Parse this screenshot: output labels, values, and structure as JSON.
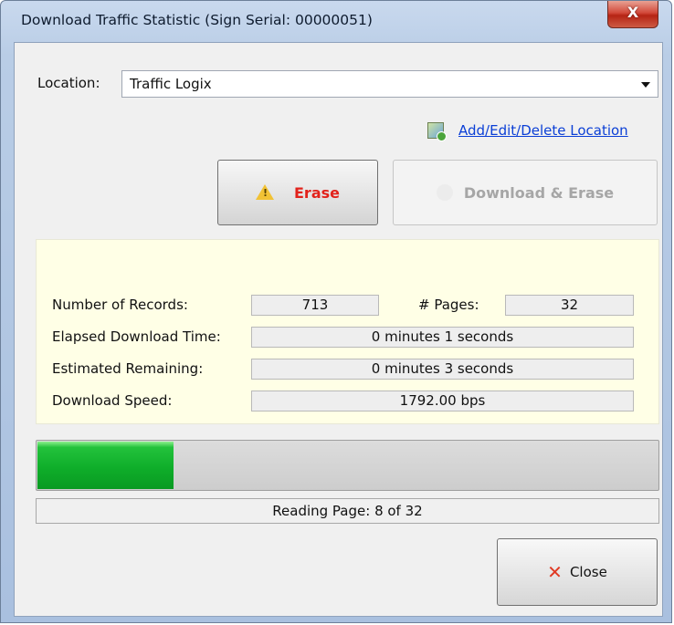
{
  "window": {
    "title": "Download Traffic Statistic (Sign Serial: 00000051)",
    "close_glyph": "X"
  },
  "location": {
    "label": "Location:",
    "selected": "Traffic Logix",
    "link_text": "Add/Edit/Delete Location",
    "link_icon": "map-add-icon"
  },
  "buttons": {
    "erase_label": "Erase",
    "erase_icon": "warning-icon",
    "download_erase_label": "Download & Erase",
    "download_erase_icon": "download-icon",
    "close_label": "Close",
    "close_icon": "close-x-icon"
  },
  "stats": {
    "records_label": "Number of Records:",
    "records_value": "713",
    "pages_label": "# Pages:",
    "pages_value": "32",
    "elapsed_label": "Elapsed Download Time:",
    "elapsed_value": "0 minutes 1 seconds",
    "remaining_label": "Estimated Remaining:",
    "remaining_value": "0 minutes 3 seconds",
    "speed_label": "Download Speed:",
    "speed_value": "1792.00 bps"
  },
  "progress": {
    "fraction": 0.22,
    "status_text": "Reading Page: 8 of 32"
  },
  "colors": {
    "erase_text": "#e2221b",
    "progress_green": "#0fae2a",
    "stats_background": "#ffffe6",
    "link": "#0b3fd6"
  }
}
